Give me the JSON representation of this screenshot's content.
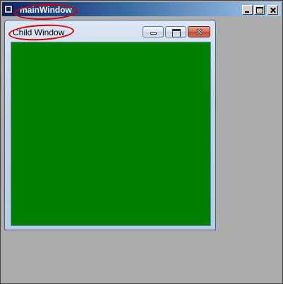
{
  "main_window": {
    "title": "mainWindow",
    "background_color": "#ababab",
    "controls": [
      "minimize-icon",
      "maximize-icon",
      "close-icon"
    ]
  },
  "child_window": {
    "title": "Child Window",
    "content_color": "#008000",
    "controls": [
      "minimize-icon",
      "maximize-icon",
      "close-icon"
    ]
  },
  "annotation_color": "#d50000"
}
